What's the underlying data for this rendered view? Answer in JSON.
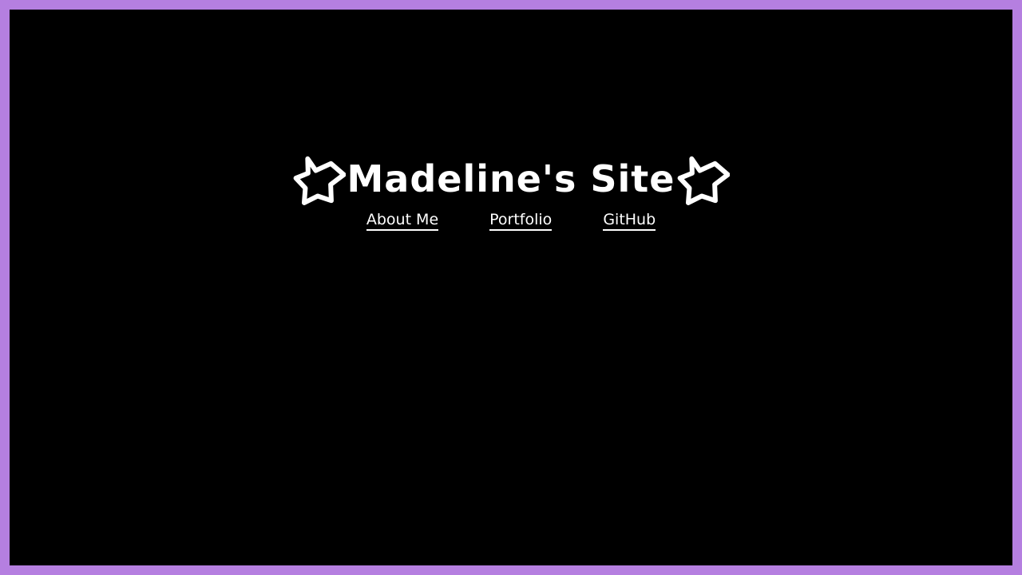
{
  "site": {
    "title": "Madeline's Site",
    "left_icon": "star-outline-icon",
    "right_icon": "star-outline-icon"
  },
  "nav": {
    "items": [
      {
        "label": "About Me"
      },
      {
        "label": "Portfolio"
      },
      {
        "label": "GitHub"
      }
    ]
  },
  "colors": {
    "frame_border": "#b57fe0",
    "background": "#000000",
    "text": "#ffffff"
  }
}
